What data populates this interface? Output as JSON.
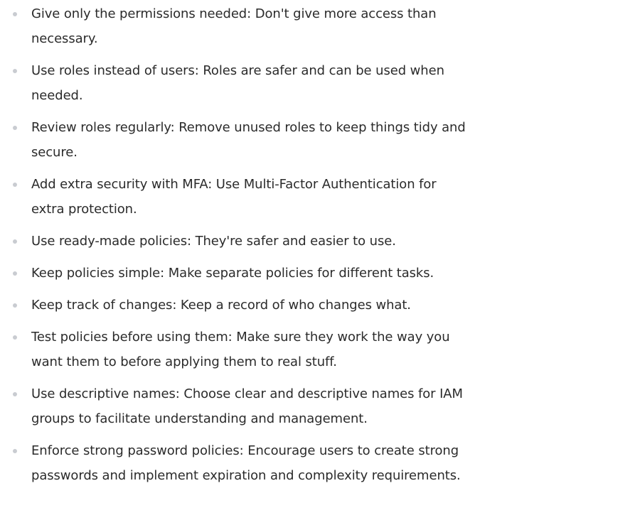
{
  "list": {
    "items": [
      "Give only the permissions needed: Don't give more access than necessary.",
      "Use roles instead of users: Roles are safer and can be used when needed.",
      "Review roles regularly: Remove unused roles to keep things tidy and secure.",
      "Add extra security with MFA: Use Multi-Factor Authentication for extra protection.",
      "Use ready-made policies: They're safer and easier to use.",
      "Keep policies simple: Make separate policies for different tasks.",
      "Keep track of changes: Keep a record of who changes what.",
      "Test policies before using them: Make sure they work the way you want them to before applying them to real stuff.",
      "Use descriptive names: Choose clear and descriptive names for IAM groups to facilitate understanding and management.",
      "Enforce strong password policies: Encourage users to create strong passwords and implement expiration and complexity requirements."
    ]
  }
}
